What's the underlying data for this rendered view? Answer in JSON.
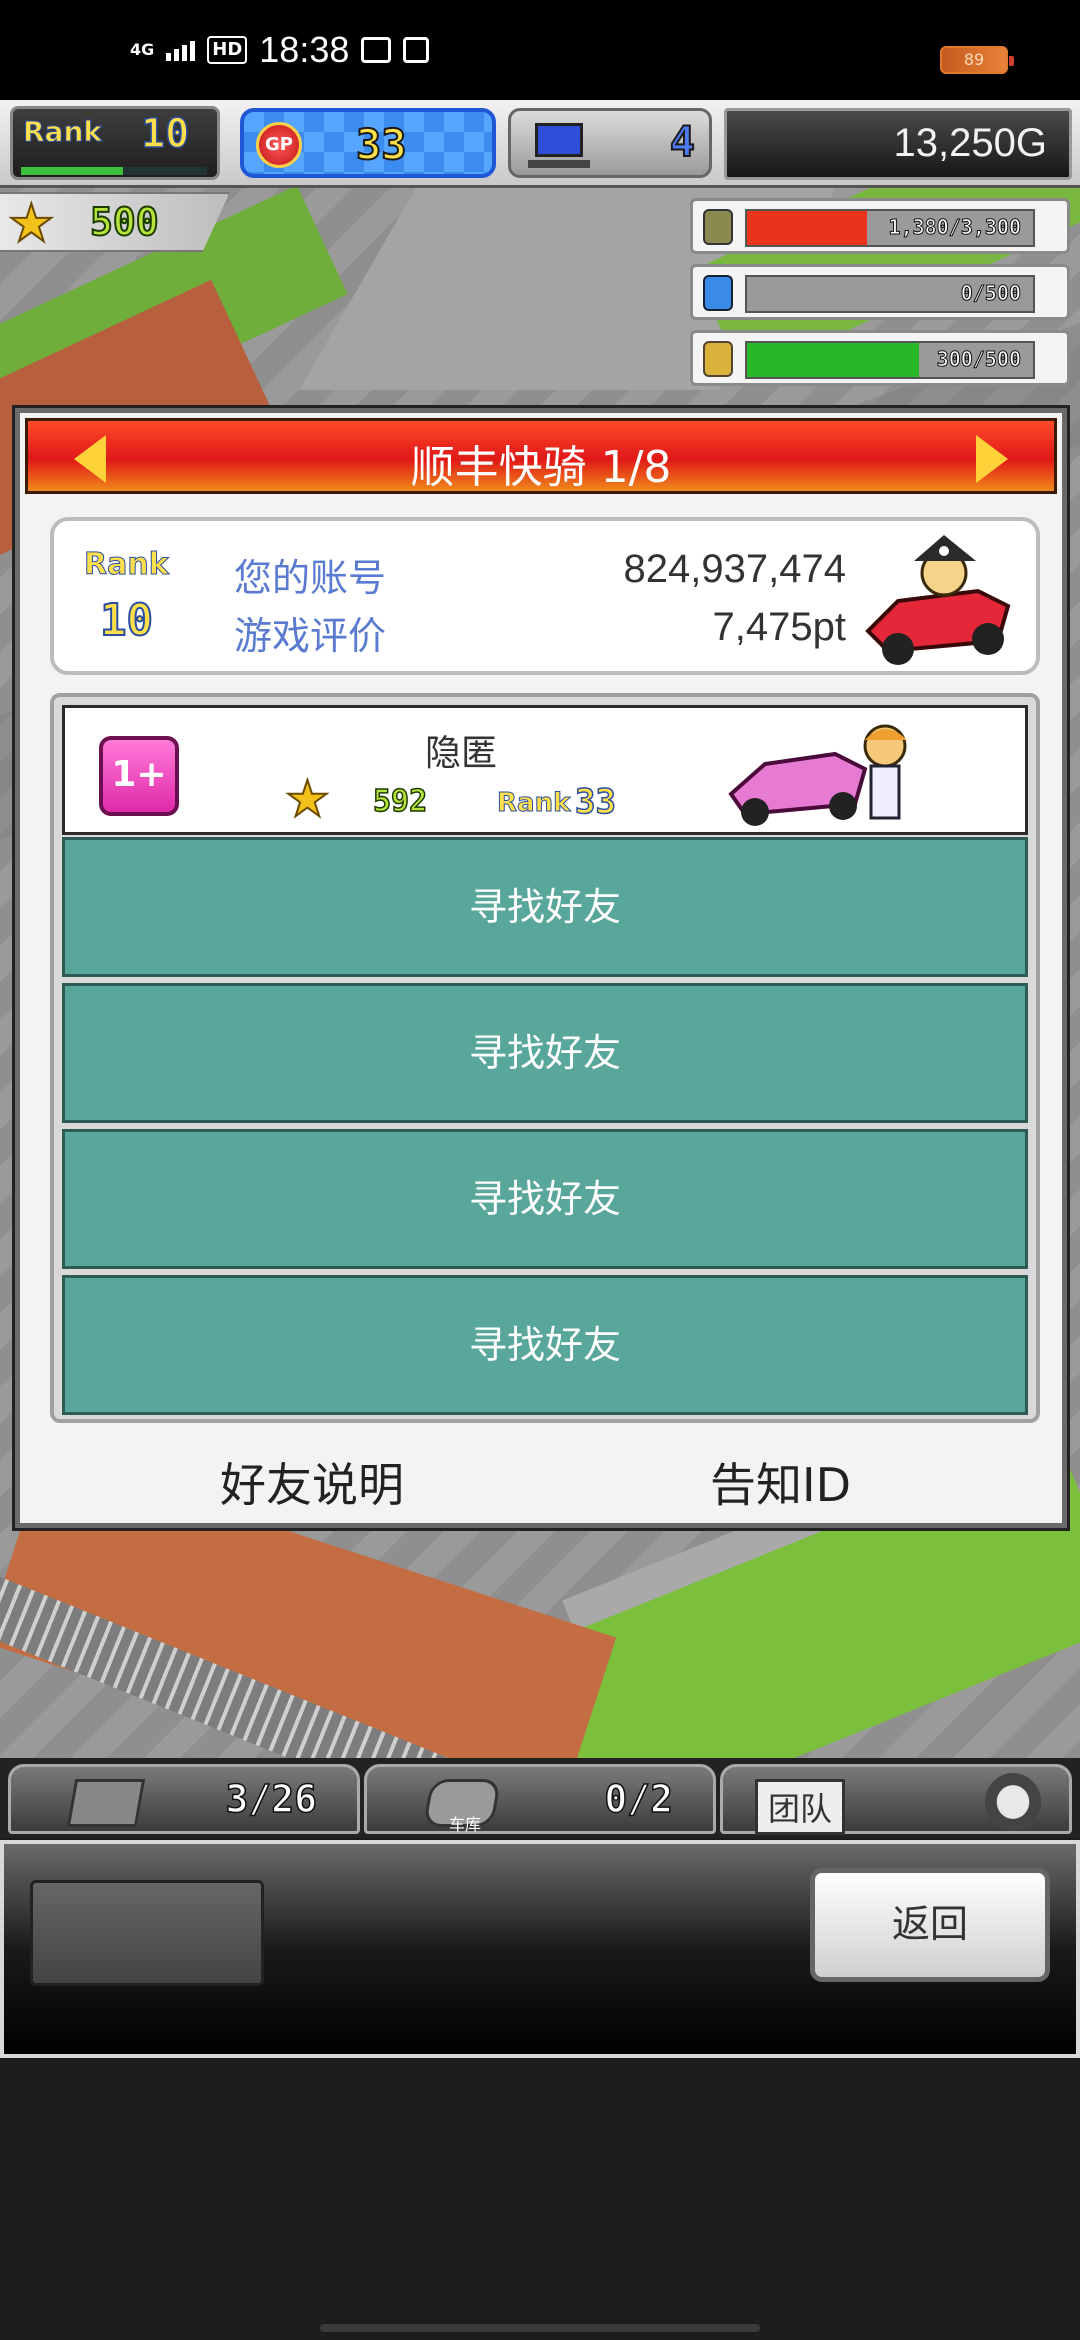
{
  "status_bar": {
    "network": "4G",
    "hd": "HD",
    "time": "18:38",
    "battery": "89"
  },
  "hud": {
    "rank_label": "Rank",
    "rank": "10",
    "rank_progress": 0.55,
    "gp_icon_text": "GP",
    "gp": "33",
    "pc_count": "4",
    "money": "13,250G",
    "stars": "500"
  },
  "resources": [
    {
      "icon": "coins-icon",
      "text": "1,380/3,300",
      "fraction": 0.42,
      "color": "#e8341c"
    },
    {
      "icon": "fuel-icon",
      "text": "0/500",
      "fraction": 0.0,
      "color": "#2a7de0"
    },
    {
      "icon": "grain-icon",
      "text": "300/500",
      "fraction": 0.6,
      "color": "#27b827"
    }
  ],
  "dialog": {
    "title": "顺丰快骑 1/8",
    "account": {
      "rank_label": "Rank",
      "rank": "10",
      "id_label": "您的账号",
      "id_value": "824,937,474",
      "score_label": "游戏评价",
      "score_value": "7,475pt"
    },
    "friend": {
      "badge": "1+",
      "name": "隐匿",
      "stars": "592",
      "rank_label": "Rank",
      "rank": "33"
    },
    "find_friend_labels": [
      "寻找好友",
      "寻找好友",
      "寻找好友",
      "寻找好友"
    ],
    "footer_left": "好友说明",
    "footer_right": "告知ID"
  },
  "bottom_tabs": {
    "storage_count": "3/26",
    "garage_label": "车库",
    "garage_count": "0/2",
    "team_label": "团队"
  },
  "panel": {
    "back_label": "返回"
  }
}
